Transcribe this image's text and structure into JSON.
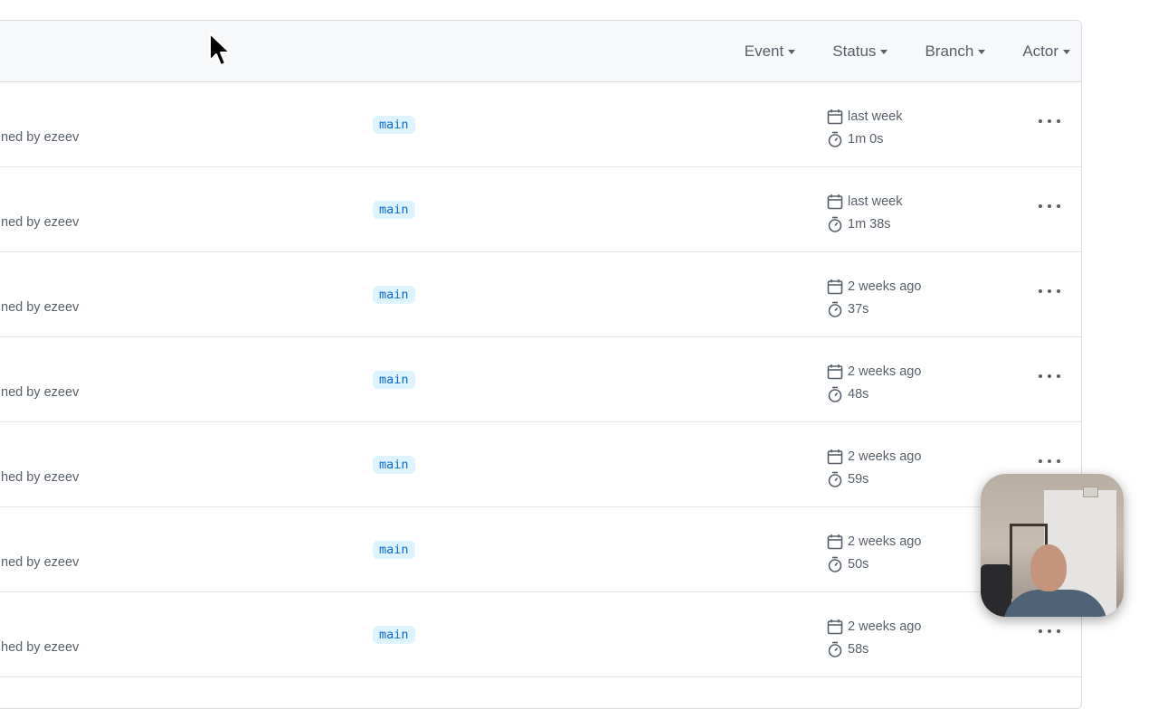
{
  "filters": [
    {
      "label": "Event"
    },
    {
      "label": "Status"
    },
    {
      "label": "Branch"
    },
    {
      "label": "Actor"
    }
  ],
  "runs": [
    {
      "actor_text": "ned by ezeev",
      "branch": "main",
      "when": "last week",
      "duration": "1m 0s"
    },
    {
      "actor_text": "ned by ezeev",
      "branch": "main",
      "when": "last week",
      "duration": "1m 38s"
    },
    {
      "actor_text": "ned by ezeev",
      "branch": "main",
      "when": "2 weeks ago",
      "duration": "37s"
    },
    {
      "actor_text": "ned by ezeev",
      "branch": "main",
      "when": "2 weeks ago",
      "duration": "48s"
    },
    {
      "actor_text": "hed by ezeev",
      "branch": "main",
      "when": "2 weeks ago",
      "duration": "59s"
    },
    {
      "actor_text": "ned by ezeev",
      "branch": "main",
      "when": "2 weeks ago",
      "duration": "50s"
    },
    {
      "actor_text": "hed by ezeev",
      "branch": "main",
      "when": "2 weeks ago",
      "duration": "58s"
    }
  ],
  "icons": {
    "calendar": "calendar-icon",
    "stopwatch": "stopwatch-icon",
    "kebab": "kebab-horizontal-icon",
    "caret": "triangle-down-icon",
    "cursor": "mouse-pointer-icon"
  },
  "colors": {
    "branch_bg": "#ddf4ff",
    "branch_fg": "#0969da",
    "muted_text": "#57606a",
    "header_bg": "#f6f8fa"
  }
}
